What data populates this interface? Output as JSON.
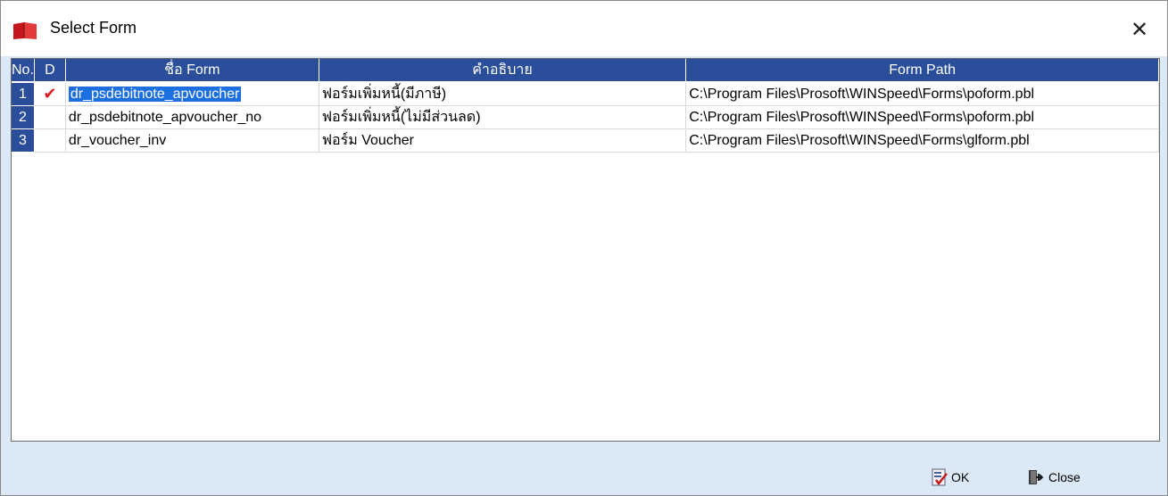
{
  "window": {
    "title": "Select Form",
    "close_glyph": "✕"
  },
  "grid": {
    "columns": [
      "No.",
      "D",
      "ชื่อ Form",
      "คำอธิบาย",
      "Form Path"
    ],
    "rows": [
      {
        "no": "1",
        "check": "✔",
        "form": "dr_psdebitnote_apvoucher",
        "desc": "ฟอร์มเพิ่มหนี้(มีภาษี)",
        "path": "C:\\Program Files\\Prosoft\\WINSpeed\\Forms\\poform.pbl"
      },
      {
        "no": "2",
        "check": "",
        "form": "dr_psdebitnote_apvoucher_no",
        "desc": "ฟอร์มเพิ่มหนี้(ไม่มีส่วนลด)",
        "path": "C:\\Program Files\\Prosoft\\WINSpeed\\Forms\\poform.pbl"
      },
      {
        "no": "3",
        "check": "",
        "form": "dr_voucher_inv",
        "desc": "ฟอร์ม Voucher",
        "path": "C:\\Program Files\\Prosoft\\WINSpeed\\Forms\\glform.pbl"
      }
    ]
  },
  "buttons": {
    "ok_label": "OK",
    "close_label": "Close"
  },
  "icons": {
    "app": "red-book-icon",
    "ok": "ok-document-check-icon",
    "close": "exit-door-icon"
  },
  "colors": {
    "header_blue": "#2b4e9a",
    "selection": "#1c6fe0",
    "check_red": "#e0191e",
    "dialog_bg": "#dbe8f6"
  }
}
